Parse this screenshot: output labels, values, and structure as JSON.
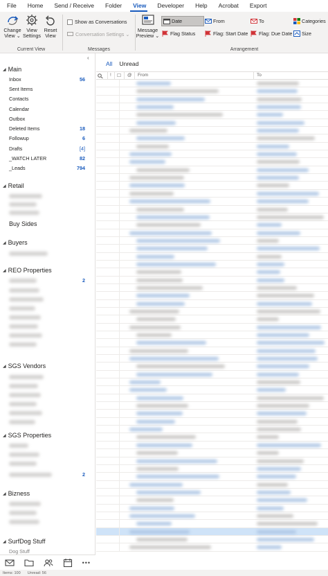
{
  "menu": [
    "File",
    "Home",
    "Send / Receive",
    "Folder",
    "View",
    "Developer",
    "Help",
    "Acrobat",
    "Export"
  ],
  "active_menu": "View",
  "ribbon": {
    "current_view": {
      "label": "Current View",
      "change_view": "Change View",
      "change_view_caret": "⌄",
      "view_settings": "View Settings",
      "reset_view": "Reset View"
    },
    "messages": {
      "label": "Messages",
      "show_as_conversations": "Show as Conversations",
      "conversation_settings": "Conversation Settings",
      "conversation_settings_caret": "⌄"
    },
    "message_preview": "Message Preview",
    "message_preview_caret": "⌄",
    "arrangement": {
      "label": "Arrangement",
      "items": [
        "Date",
        "From",
        "To",
        "Categories",
        "Flag Status",
        "Flag: Start Date",
        "Flag: Due Date",
        "Size"
      ]
    }
  },
  "nav": {
    "collapse": "‹",
    "main": {
      "title": "Main",
      "folders": [
        {
          "name": "Inbox",
          "count": "56"
        },
        {
          "name": "Sent Items",
          "count": ""
        },
        {
          "name": "Contacts",
          "count": ""
        },
        {
          "name": "Calendar",
          "count": ""
        },
        {
          "name": "Outbox",
          "count": ""
        },
        {
          "name": "Deleted Items",
          "count": "18"
        },
        {
          "name": "Followup",
          "count": "6"
        },
        {
          "name": "Drafts",
          "count": "[4]"
        },
        {
          "name": "_WATCH LATER",
          "count": "82"
        },
        {
          "name": "_Leads",
          "count": "794"
        }
      ]
    },
    "retail": "Retail",
    "buy_sides": "Buy Sides",
    "buyers": "Buyers",
    "reo_properties": "REO Properties",
    "reo_count": "2",
    "sgs_vendors": "SGS Vendors",
    "sgs_properties": "SGS Properties",
    "sgs_properties_count": "2",
    "bizness": "Bizness",
    "surfdog": "SurfDog Stuff",
    "surfdog_sub": "Dog Stuff",
    "more_icon": "•••"
  },
  "list": {
    "tabs": [
      "All",
      "Unread"
    ],
    "col_from": "From",
    "col_to": "To",
    "col_icons": [
      "!",
      "☐",
      "@"
    ]
  },
  "status": {
    "items": "Items: 100",
    "unread": "Unread: 56"
  },
  "colors": {
    "accent": "#185abd",
    "ribbon_bg": "#f3f2f1",
    "selected_row": "#cfe3f8"
  }
}
